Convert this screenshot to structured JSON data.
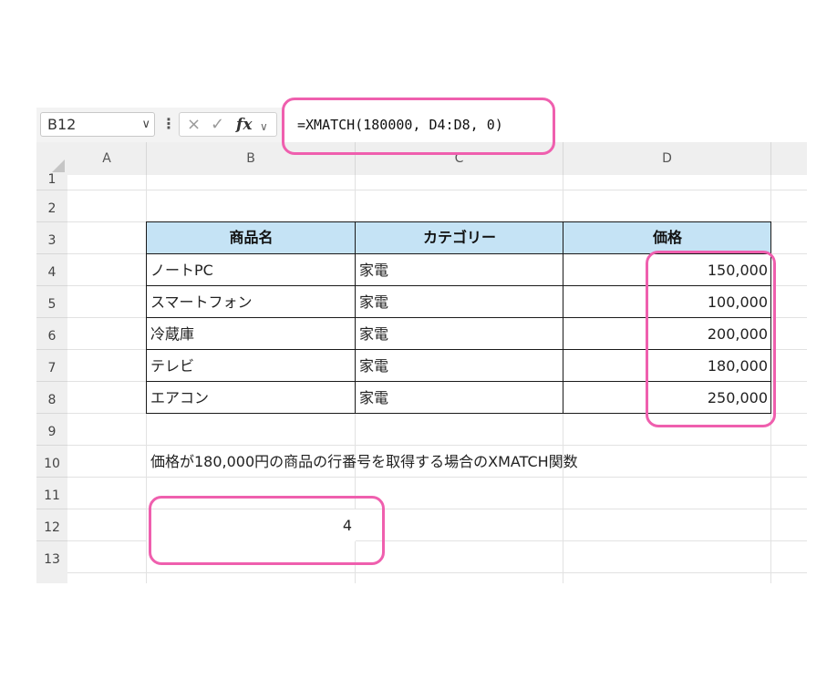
{
  "namebox": {
    "value": "B12"
  },
  "formula": {
    "text": "=XMATCH(180000, D4:D8, 0)"
  },
  "icons": {
    "cancel": "×",
    "confirm": "✓",
    "fx": "fx",
    "chevron": "∨",
    "more": "⋮"
  },
  "columns": [
    "A",
    "B",
    "C",
    "D"
  ],
  "rows": [
    "1",
    "2",
    "3",
    "4",
    "5",
    "6",
    "7",
    "8",
    "9",
    "10",
    "11",
    "12",
    "13"
  ],
  "table": {
    "headers": [
      "商品名",
      "カテゴリー",
      "価格"
    ],
    "rows": [
      [
        "ノートPC",
        "家電",
        "150,000"
      ],
      [
        "スマートフォン",
        "家電",
        "100,000"
      ],
      [
        "冷蔵庫",
        "家電",
        "200,000"
      ],
      [
        "テレビ",
        "家電",
        "180,000"
      ],
      [
        "エアコン",
        "家電",
        "250,000"
      ]
    ]
  },
  "note": "価格が180,000円の商品の行番号を取得する場合のXMATCH関数",
  "result": "4",
  "highlight_color": "#ef5fae",
  "header_fill": "#c5e3f5"
}
